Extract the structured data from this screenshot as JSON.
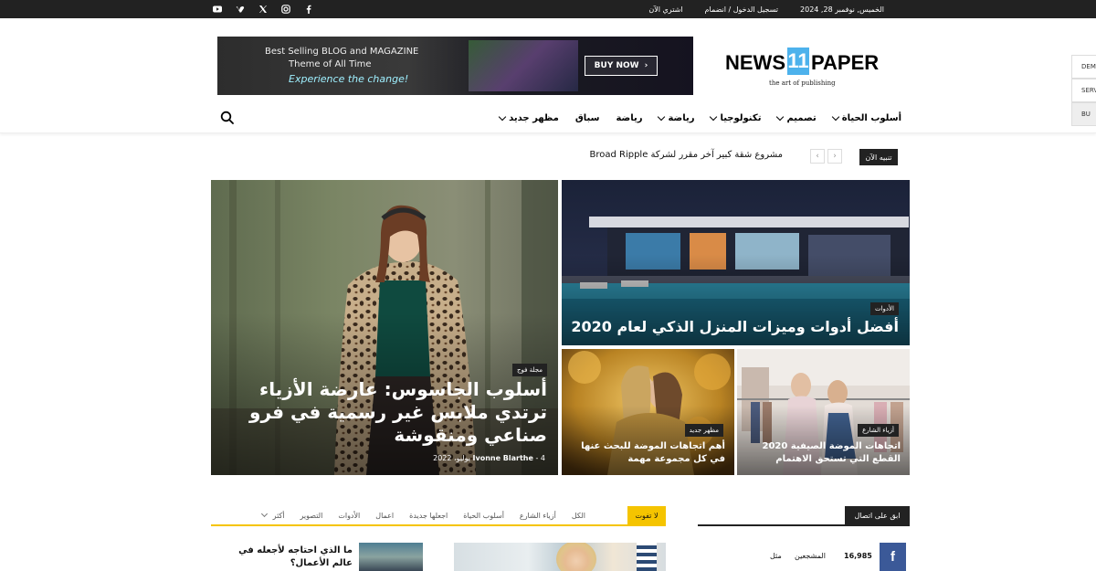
{
  "topbar": {
    "date": "الخميس, نوفمبر 28, 2024",
    "login": "تسجيل الدخول / انضمام",
    "buy": "اشتري الآن",
    "social_icons": [
      "youtube-icon",
      "vimeo-icon",
      "x-twitter-icon",
      "instagram-icon",
      "facebook-icon"
    ]
  },
  "banner": {
    "line1": "Best Selling BLOG and MAGAZINE",
    "line2": "Theme of All Time",
    "line3": "Experience the change!",
    "cta": "BUY NOW"
  },
  "logo": {
    "word1": "NEWS",
    "number": "11",
    "word2": "PAPER",
    "tagline": "the art of publishing",
    "accent": "#4db2ec"
  },
  "side_panel": [
    "DEM",
    "SERV",
    "BU"
  ],
  "nav": {
    "items": [
      {
        "label": "أسلوب الحياة",
        "dropdown": true
      },
      {
        "label": "تصميم",
        "dropdown": true
      },
      {
        "label": "تكنولوجيا",
        "dropdown": true
      },
      {
        "label": "رياضة",
        "dropdown": true
      },
      {
        "label": "رياضة",
        "dropdown": false
      },
      {
        "label": "سباق",
        "dropdown": false
      },
      {
        "label": "مظهر جديد",
        "dropdown": true
      }
    ]
  },
  "trending": {
    "label": "تنبيه الآن",
    "headline": "مشروع شقة كبير آخر مقرر لشركة Broad Ripple"
  },
  "grid": {
    "main": {
      "category": "مجلة فوج",
      "title": "أسلوب الجاسوس: عارضة الأزياء ترتدي ملابس غير رسمية في فرو صناعي ومنقوشة",
      "author": "Ivonne Blarthe",
      "date": "4 يوليو، 2022"
    },
    "top_right": {
      "category": "الأدوات",
      "title": "أفضل أدوات وميزات المنزل الذكي لعام 2020"
    },
    "bottom_left": {
      "category": "مظهر جديد",
      "title": "أهم اتجاهات الموضة للبحث عنها في كل مجموعة مهمة"
    },
    "bottom_right": {
      "category": "أزياء الشارع",
      "title": "اتجاهات الموضة الصيفية 2020 القطع التي تستحق الاهتمام"
    }
  },
  "dont_miss": {
    "label": "لا تفوت",
    "tabs": [
      "الكل",
      "أزياء الشارع",
      "أسلوب الحياة",
      "اجعلها جديدة",
      "اعمال",
      "الأدوات",
      "التصوير",
      "أكثر"
    ],
    "post_title": "ما الذي احتاجه لأجعله في عالم الأعمال؟"
  },
  "stay_connected": {
    "label": "ابق على اتصال",
    "facebook": {
      "count": "16,985",
      "fans": "المشجعين",
      "action": "مثل",
      "color": "#3b5998"
    }
  }
}
